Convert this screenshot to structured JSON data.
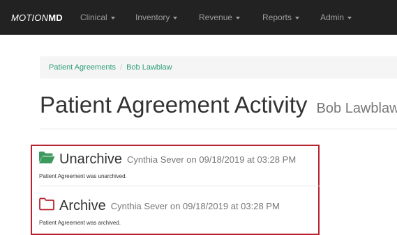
{
  "navbar": {
    "brand_part1": "MOTION",
    "brand_part2": "MD",
    "items": [
      {
        "label": "Clinical"
      },
      {
        "label": "Inventory"
      },
      {
        "label": "Revenue"
      },
      {
        "label": "Reports"
      },
      {
        "label": "Admin"
      }
    ]
  },
  "breadcrumb": {
    "items": [
      "Patient Agreements",
      "Bob Lawblaw"
    ],
    "separator": "/"
  },
  "page": {
    "title": "Patient Agreement Activity",
    "subtitle": "Bob Lawblaw"
  },
  "activity": [
    {
      "icon": "folder-open-icon",
      "action": "Unarchive",
      "meta": "Cynthia Sever on 09/18/2019 at 03:28 PM",
      "description": "Patient Agreement was unarchived."
    },
    {
      "icon": "folder-outline-icon",
      "action": "Archive",
      "meta": "Cynthia Sever on 09/18/2019 at 03:28 PM",
      "description": "Patient Agreement was archived."
    }
  ],
  "colors": {
    "navbar_bg": "#222222",
    "link": "#2e9e7a",
    "folder_green": "#3c9a5f",
    "highlight_border": "#b8232f"
  }
}
